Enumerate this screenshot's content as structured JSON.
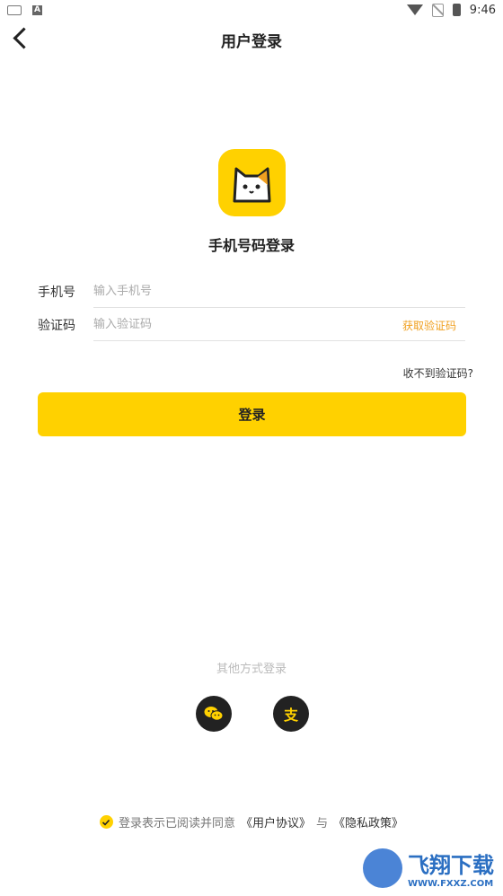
{
  "status": {
    "time": "9:46"
  },
  "header": {
    "title": "用户登录"
  },
  "login": {
    "heading": "手机号码登录",
    "phone_label": "手机号",
    "phone_placeholder": "输入手机号",
    "code_label": "验证码",
    "code_placeholder": "输入验证码",
    "get_code": "获取验证码",
    "no_code": "收不到验证码?",
    "button": "登录"
  },
  "other": {
    "title": "其他方式登录"
  },
  "agreement": {
    "text": "登录表示已阅读并同意",
    "user_link": "《用户协议》",
    "and": "与",
    "privacy_link": "《隐私政策》"
  },
  "watermark": {
    "text": "飞翔下载",
    "sub": "WWW.FXXZ.COM"
  },
  "colors": {
    "accent": "#FFD100",
    "link": "#f0a020"
  }
}
